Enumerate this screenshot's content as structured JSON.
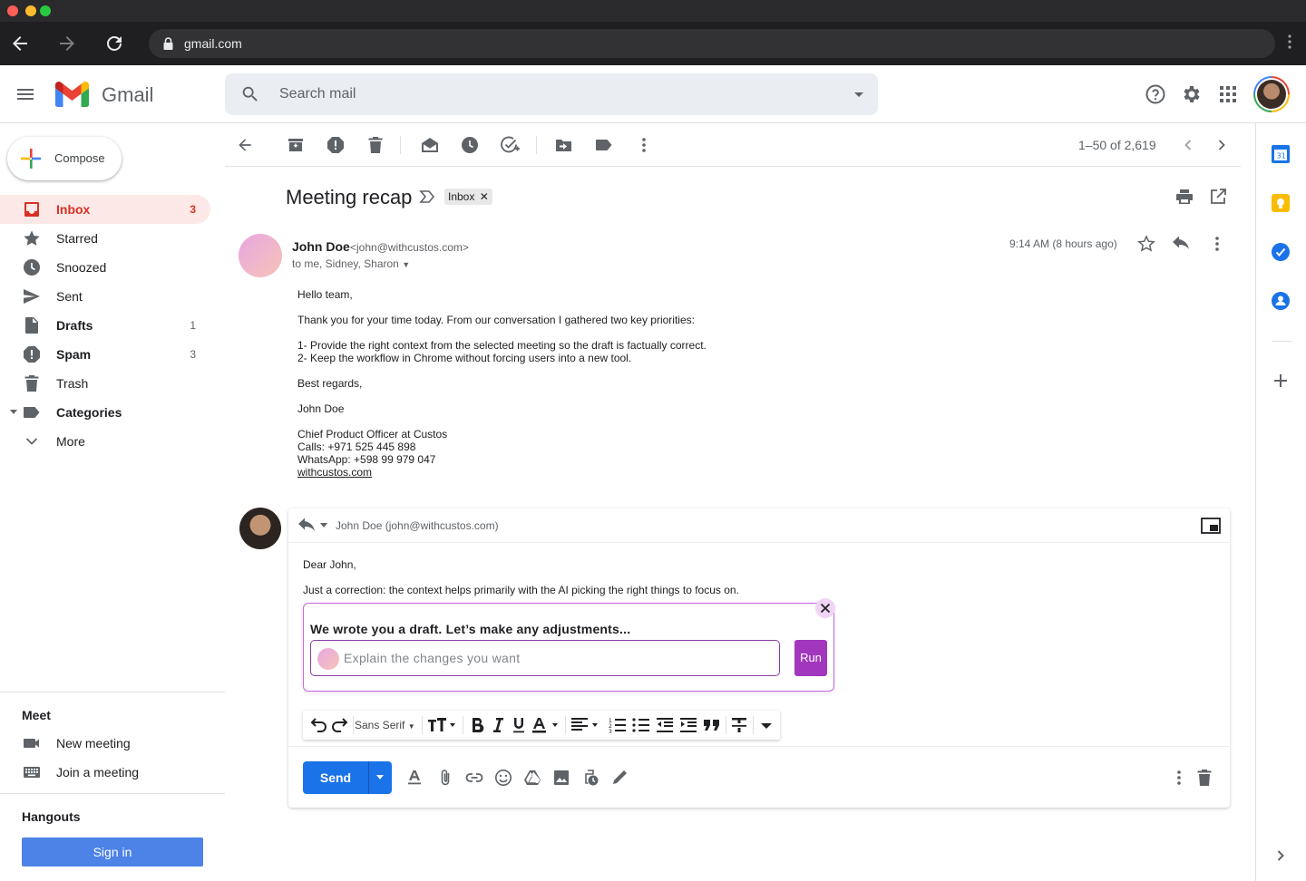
{
  "browser": {
    "url": "gmail.com",
    "traffic_colors": [
      "#ff5f57",
      "#febc2e",
      "#28c840"
    ]
  },
  "header": {
    "app_name": "Gmail",
    "search_placeholder": "Search mail"
  },
  "sidebar": {
    "compose_label": "Compose",
    "items": [
      {
        "label": "Inbox",
        "count": "3",
        "icon": "inbox-icon",
        "active": true,
        "bold": true
      },
      {
        "label": "Starred",
        "count": "",
        "icon": "star-icon"
      },
      {
        "label": "Snoozed",
        "count": "",
        "icon": "clock-icon"
      },
      {
        "label": "Sent",
        "count": "",
        "icon": "send-icon"
      },
      {
        "label": "Drafts",
        "count": "1",
        "icon": "draft-icon",
        "bold": true
      },
      {
        "label": "Spam",
        "count": "3",
        "icon": "spam-icon",
        "bold": true
      },
      {
        "label": "Trash",
        "count": "",
        "icon": "trash-icon"
      },
      {
        "label": "Categories",
        "count": "",
        "icon": "label-icon",
        "bold": true
      },
      {
        "label": "More",
        "count": "",
        "icon": "chevron-down-icon"
      }
    ],
    "meet": {
      "title": "Meet",
      "new_meeting": "New meeting",
      "join_meeting": "Join a meeting"
    },
    "hangouts": {
      "title": "Hangouts",
      "sign_in": "Sign in"
    }
  },
  "toolbar": {
    "pagination": "1–50 of 2,619"
  },
  "email": {
    "subject": "Meeting recap",
    "label_chip": "Inbox",
    "sender_name": "John Doe",
    "sender_email": "<john@withcustos.com>",
    "recipients": "to me, Sidney, Sharon",
    "time": "9:14 AM (8 hours ago)",
    "body": {
      "greeting": "Hello team,",
      "intro": "Thank you for your time today. From our conversation I gathered two key priorities:",
      "point1": "1- Provide the right context from the selected meeting so the draft is factually correct.",
      "point2": "2- Keep the workflow in Chrome without forcing users into a new tool.",
      "closing": "Best regards,",
      "signature_name": "John Doe",
      "sig_title": "Chief Product Officer at Custos",
      "sig_calls": "Calls: +971 525 445 898",
      "sig_whatsapp": "WhatsApp: +598 99 979 047",
      "sig_link": "withcustos.com"
    }
  },
  "reply": {
    "to": "John Doe (john@withcustos.com)",
    "line1": "Dear John,",
    "line2": "Just a correction: the context helps primarily with the AI picking the right things to focus on.",
    "ai_panel": {
      "title": "We wrote you a draft. Let’s make any adjustments...",
      "placeholder": "Explain the changes you want",
      "run_label": "Run",
      "accent": "#a236bd"
    },
    "font_name": "Sans Serif",
    "send_label": "Send"
  }
}
